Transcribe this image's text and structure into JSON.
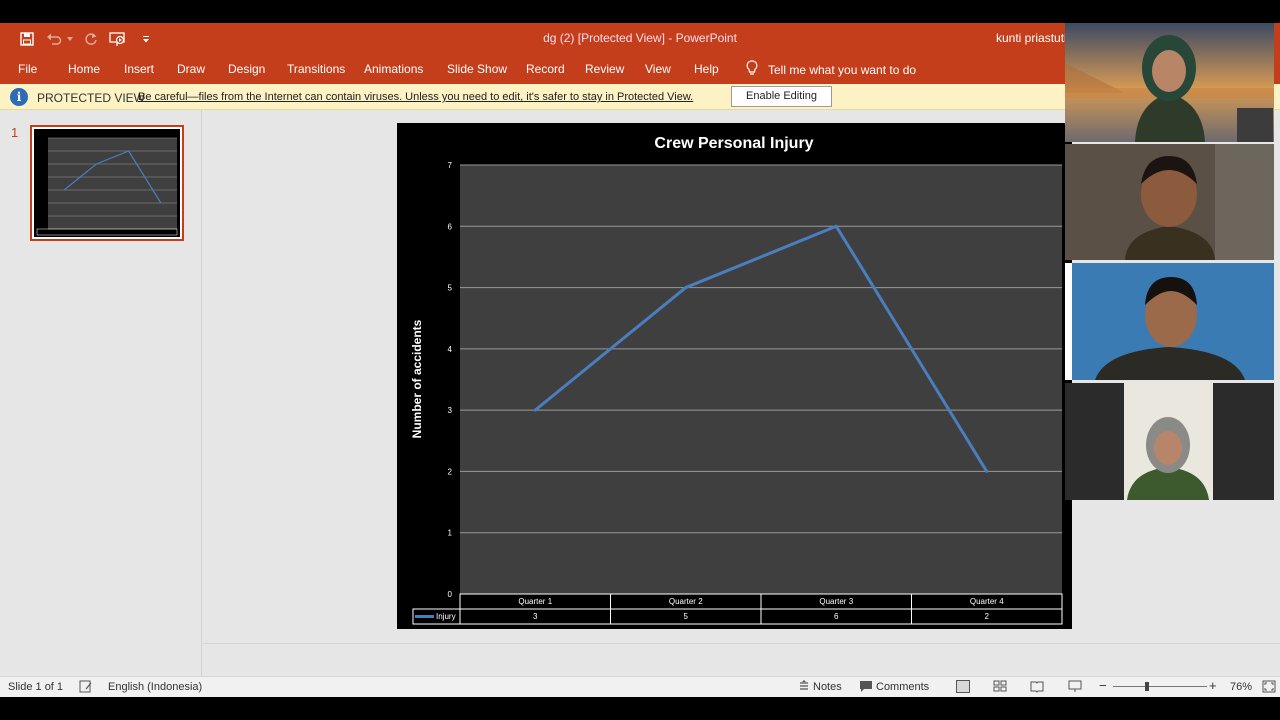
{
  "window": {
    "title": "dg (2) [Protected View]  -  PowerPoint",
    "user": "kunti priastuti"
  },
  "tabs": [
    "File",
    "Home",
    "Insert",
    "Draw",
    "Design",
    "Transitions",
    "Animations",
    "Slide Show",
    "Record",
    "Review",
    "View",
    "Help"
  ],
  "tell_me": "Tell me what you want to do",
  "protected_view": {
    "label": "PROTECTED VIEW",
    "message": "Be careful—files from the Internet can contain viruses. Unless you need to edit, it's safer to stay in Protected View.",
    "button": "Enable Editing"
  },
  "thumbnails": {
    "number": "1"
  },
  "status": {
    "slide": "Slide 1 of 1",
    "language": "English (Indonesia)",
    "notes": "Notes",
    "comments": "Comments",
    "zoom": "76%"
  },
  "colors": {
    "accent": "#c43e1c",
    "chart_bg": "#3f3f3f",
    "line": "#4a7ebf"
  },
  "chart_data": {
    "type": "line",
    "title": "Crew Personal Injury",
    "xlabel": "",
    "ylabel": "Number of accidents",
    "categories": [
      "Quarter 1",
      "Quarter 2",
      "Quarter 3",
      "Quarter 4"
    ],
    "series": [
      {
        "name": "Injury",
        "values": [
          3,
          5,
          6,
          2
        ]
      }
    ],
    "ylim": [
      0,
      7
    ],
    "yticks": [
      "0",
      "1",
      "2",
      "3",
      "4",
      "5",
      "6",
      "7"
    ],
    "grid": true,
    "legend": "data-table"
  }
}
